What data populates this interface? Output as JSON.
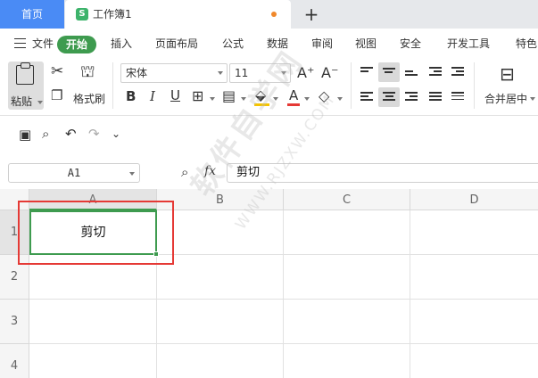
{
  "tabs": {
    "home_label": "首页",
    "doc_icon": "S",
    "doc_name": "工作簿1",
    "new_tab": "+"
  },
  "menu": {
    "file": "文件",
    "items": [
      "开始",
      "插入",
      "页面布局",
      "公式",
      "数据",
      "审阅",
      "视图",
      "安全",
      "开发工具",
      "特色"
    ]
  },
  "ribbon": {
    "paste": "粘贴",
    "format_painter": "格式刷",
    "font_name": "宋体",
    "font_size": "11",
    "grow_font": "A⁺",
    "shrink_font": "A⁻",
    "bold": "B",
    "italic": "I",
    "underline": "U",
    "font_color_letter": "A",
    "merge_center": "合并居中",
    "font_color": "#e53935",
    "fill_color": "#f5c400"
  },
  "formula_bar": {
    "cell_ref": "A1",
    "fx": "fx",
    "content": "剪切"
  },
  "grid": {
    "columns": [
      "A",
      "B",
      "C",
      "D"
    ],
    "rows": [
      "1",
      "2",
      "3",
      "4"
    ],
    "cell_a1": "剪切",
    "selection_color": "#3e9b4f"
  },
  "watermark": {
    "main": "软件自学网",
    "url": "WWW.RJZXW.COM"
  }
}
